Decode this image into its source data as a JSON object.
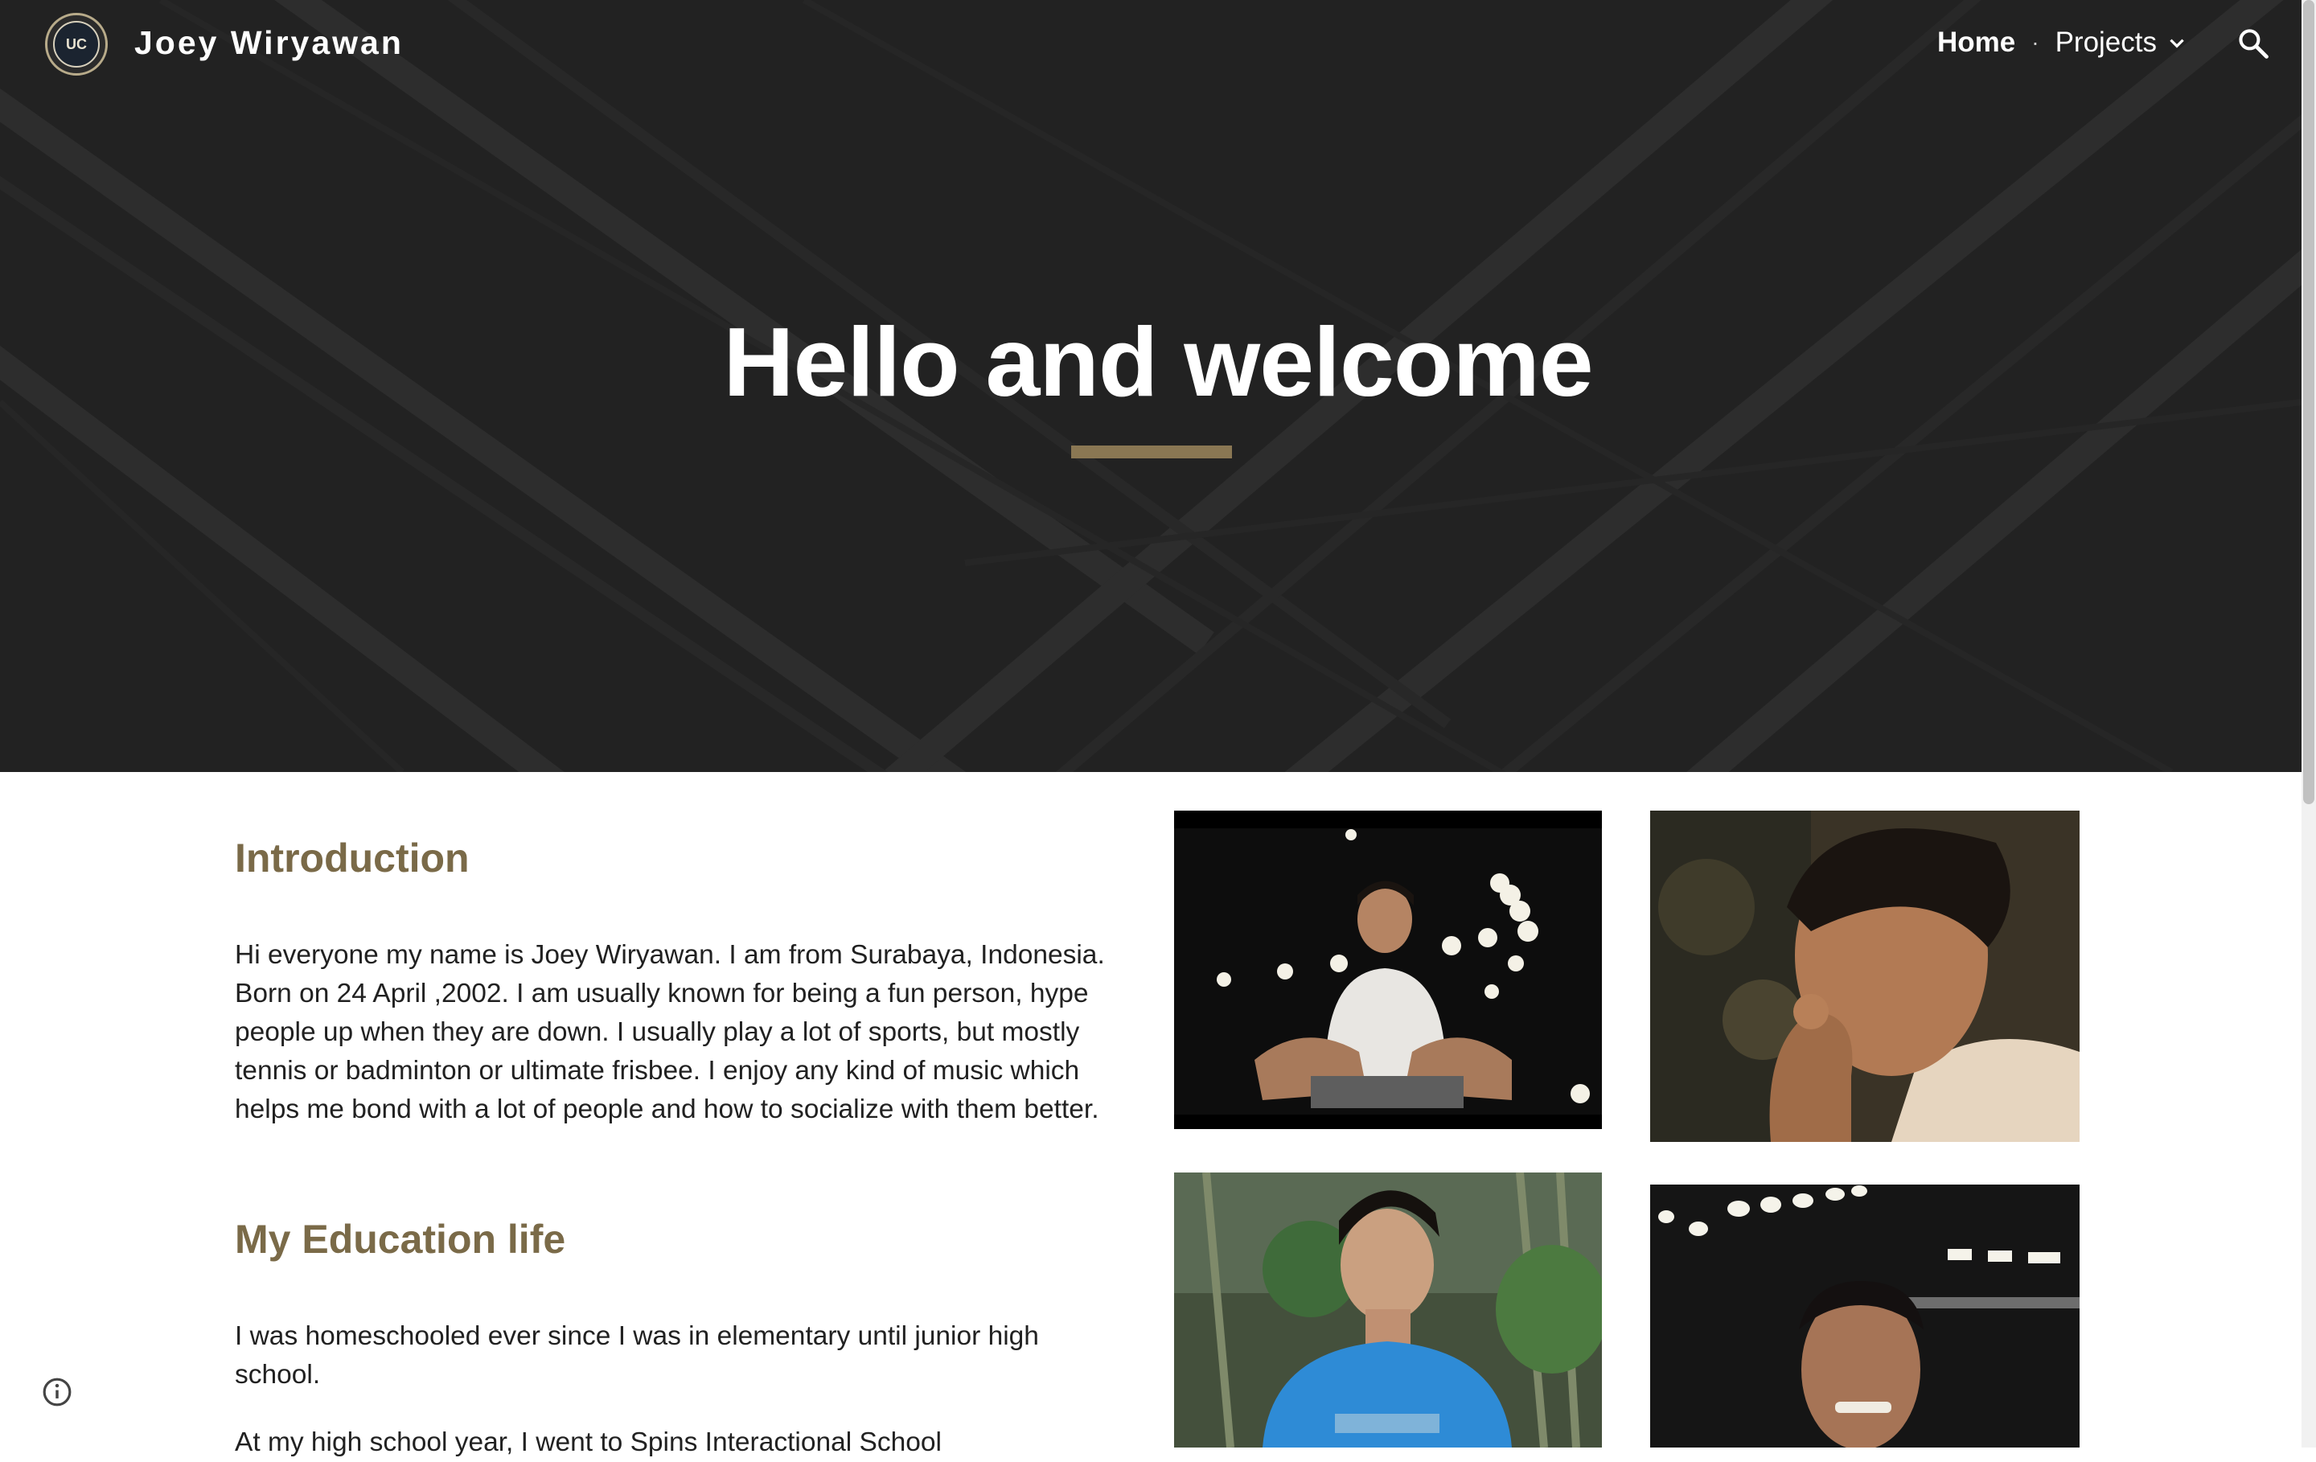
{
  "header": {
    "site_title": "Joey Wiryawan",
    "logo_text": "UC",
    "nav": [
      {
        "label": "Home",
        "active": true
      },
      {
        "label": "Projects",
        "has_dropdown": true
      }
    ],
    "search_icon": "search-icon"
  },
  "hero": {
    "title": "Hello and welcome",
    "accent_color": "#8a7753"
  },
  "sections": [
    {
      "heading": "Introduction",
      "body": "Hi everyone my name is Joey Wiryawan. I am from Surabaya, Indonesia. Born on 24 April ,2002. I am usually known for being a fun person, hype people up when they are down. I usually play a lot of sports, but mostly tennis or badminton or ultimate frisbee. I enjoy any kind of music which helps me bond with a lot of people and how to socialize with them better."
    },
    {
      "heading": "My Education life",
      "body": "I was homeschooled ever since I was in elementary until junior high school.",
      "body2": "At my high school year, I went to Spins Interactional School"
    }
  ],
  "colors": {
    "heading": "#7a6a48",
    "hero_background": "#262626",
    "text": "#212121"
  }
}
